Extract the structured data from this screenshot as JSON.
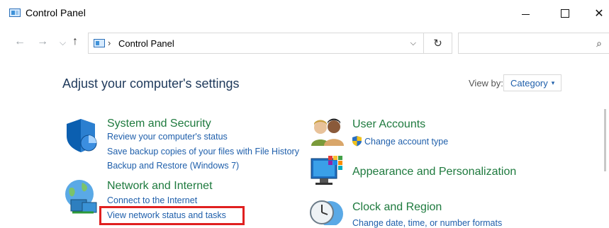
{
  "window": {
    "title": "Control Panel",
    "controls": {
      "minimize": "—",
      "maximize": "□",
      "close": "✕"
    }
  },
  "address_bar": {
    "nav": {
      "back": "←",
      "forward": "→",
      "recent": "⌵",
      "up": "↑"
    },
    "breadcrumb_separator": "›",
    "path": "Control Panel",
    "dropdown": "⌵",
    "refresh": "↻",
    "search_placeholder": "",
    "search_icon": "⌕"
  },
  "content": {
    "heading": "Adjust your computer's settings",
    "view_by_label": "View by:",
    "view_by_value": "Category",
    "caret": "▾"
  },
  "categories": {
    "system_security": {
      "title": "System and Security",
      "icon": "shield-icon",
      "tasks": [
        "Review your computer's status",
        "Save backup copies of your files with File History",
        "Backup and Restore (Windows 7)"
      ]
    },
    "network_internet": {
      "title": "Network and Internet",
      "icon": "network-globe-icon",
      "tasks": [
        "Connect to the Internet",
        "View network status and tasks"
      ]
    },
    "user_accounts": {
      "title": "User Accounts",
      "icon": "users-icon",
      "tasks": [
        "Change account type"
      ]
    },
    "appearance": {
      "title": "Appearance and Personalization",
      "icon": "monitor-personalization-icon",
      "tasks": []
    },
    "clock_region": {
      "title": "Clock and Region",
      "icon": "clock-globe-icon",
      "tasks": [
        "Change date, time, or number formats"
      ]
    }
  },
  "highlight_color": "#e02020",
  "link_color": "#1f5fab",
  "category_color": "#1e7a3e"
}
